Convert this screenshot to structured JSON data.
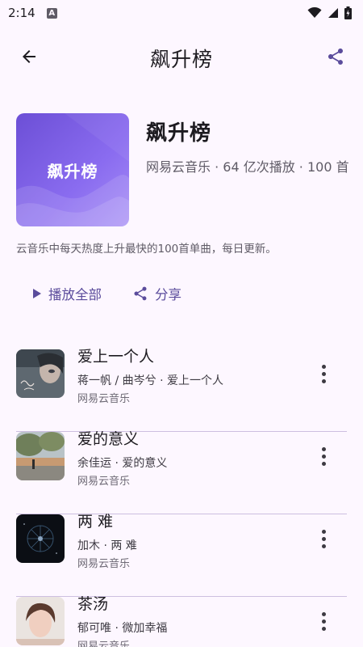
{
  "status_bar": {
    "time": "2:14",
    "notification_letter": "A"
  },
  "app_bar": {
    "title": "飙升榜"
  },
  "playlist": {
    "cover_text": "飙升榜",
    "title": "飙升榜",
    "meta": "网易云音乐 · 64 亿次播放 · 100 首",
    "description": "云音乐中每天热度上升最快的100首单曲，每日更新。"
  },
  "actions": {
    "play_all": "播放全部",
    "share": "分享"
  },
  "songs": [
    {
      "title": "爱上一个人",
      "artist": "蒋一帆 / 曲岑兮 · 爱上一个人",
      "source": "网易云音乐"
    },
    {
      "title": "爱的意义",
      "artist": "余佳运 · 爱的意义",
      "source": "网易云音乐"
    },
    {
      "title": "两 难",
      "artist": "加木 · 两 难",
      "source": "网易云音乐"
    },
    {
      "title": "茶汤",
      "artist": "郁可唯 · 微加幸福",
      "source": "网易云音乐"
    }
  ],
  "colors": {
    "background": "#fdf7ff",
    "accent": "#5b4c9c",
    "cover_gradient_start": "#6c4fd6",
    "divider": "#cdbfe0"
  },
  "icons": [
    "arrow-back-icon",
    "share-icon",
    "play-icon",
    "more-vert-icon",
    "wifi-icon",
    "signal-icon",
    "battery-icon"
  ]
}
